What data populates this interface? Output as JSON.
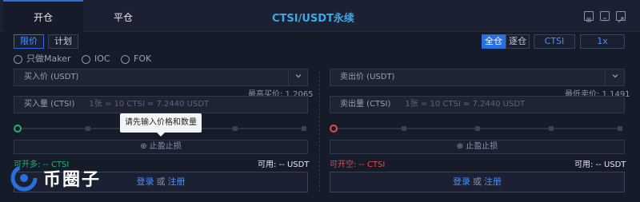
{
  "header": {
    "tab_open": "开仓",
    "tab_close": "平仓",
    "title": "CTSI/USDT永续"
  },
  "order_types": {
    "limit": "限价",
    "plan": "计划"
  },
  "radios": [
    "只做Maker",
    "IOC",
    "FOK"
  ],
  "margin": {
    "cross": "全仓",
    "isolated": "逐仓",
    "asset": "CTSI",
    "leverage": "1x"
  },
  "buy": {
    "price_placeholder": "买入价 (USDT)",
    "best_price_label": "最高买价: 1.2065",
    "qty_label": "买入量 (CTSI)",
    "qty_hint": "1张 = 10 CTSI ≈ 7.2440 USDT",
    "sltp_label": "止盈止损",
    "openable": "可开多: -- CTSI",
    "available": "可用: -- USDT",
    "login": "登录",
    "or": "或",
    "register": "注册"
  },
  "sell": {
    "price_placeholder": "卖出价 (USDT)",
    "best_price_label": "最低卖价: 1.1491",
    "qty_label": "卖出量 (CTSI)",
    "qty_hint": "1张 = 10 CTSI ≈ 7.2440 USDT",
    "sltp_label": "止盈止损",
    "openable": "可开空: -- CTSI",
    "available": "可用: -- USDT",
    "login": "登录",
    "or": "或",
    "register": "注册"
  },
  "tooltip": "请先输入价格和数量",
  "watermark": "币圈子",
  "colors": {
    "accent": "#2a6fe0",
    "title": "#3aa9e5",
    "buy": "#23b26d",
    "sell": "#e54b4b"
  }
}
